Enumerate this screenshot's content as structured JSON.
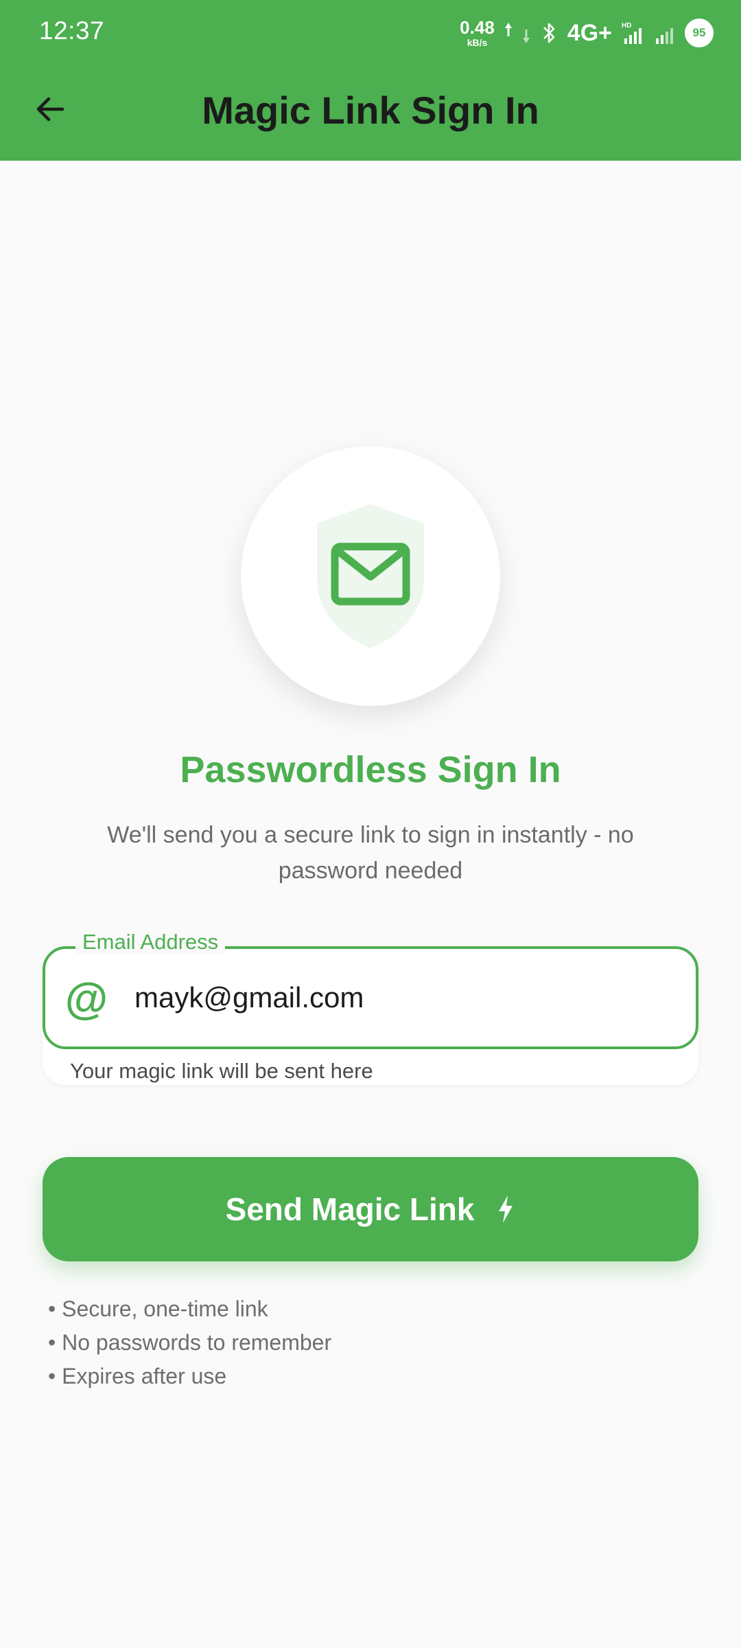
{
  "status_bar": {
    "time": "12:37",
    "net_speed_value": "0.48",
    "net_speed_unit": "kB/s",
    "network_type": "4G+",
    "battery_level": "95",
    "icons": [
      "upload-arrow-icon",
      "download-arrow-icon",
      "bluetooth-icon",
      "signal-icon",
      "signal-icon",
      "battery-icon"
    ]
  },
  "app_bar": {
    "title": "Magic Link Sign In",
    "back_icon": "arrow-left-icon",
    "color": "#4caf50"
  },
  "hero": {
    "icon": "shield-mail-icon",
    "heading": "Passwordless Sign In",
    "subtitle": "We'll send you a secure link to sign in instantly - no password needed"
  },
  "email_field": {
    "label": "Email Address",
    "value": "mayk@gmail.com",
    "icon": "at-icon",
    "helper": "Your magic link will be sent here"
  },
  "send_button": {
    "label": "Send Magic Link",
    "icon": "bolt-icon"
  },
  "features": [
    "• Secure, one-time link",
    "• No passwords to remember",
    "• Expires after use"
  ],
  "colors": {
    "accent": "#4caf50",
    "background": "#fafafa",
    "title_text": "#1b1b1b",
    "muted_text": "#6b6b6b"
  }
}
